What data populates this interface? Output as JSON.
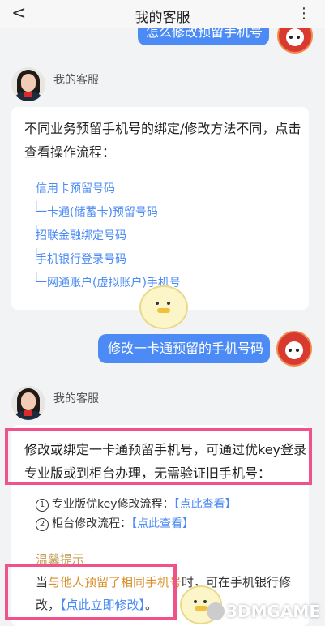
{
  "header": {
    "title": "我的客服",
    "back_glyph": "<",
    "more_glyph": "⋮"
  },
  "top_user_message": "怎么修改预留手机号",
  "conversation": {
    "agent_name": "我的客服",
    "agent_message_1": "不同业务预留手机号的绑定/修改方法不同，点击查看操作流程：",
    "links": [
      "信用卡预留号码",
      "一卡通(储蓄卡)预留号码",
      "招联金融绑定号码",
      "手机银行登录号码",
      "一网通账户(虚拟账户)手机号"
    ],
    "user_message_2": "修改一卡通预留的手机号码",
    "agent_message_2": "修改或绑定一卡通预留手机号，可通过优key登录专业版或到柜台办理，无需验证旧手机号：",
    "steps": [
      {
        "num": "1",
        "label": "专业版优key修改流程：",
        "link": "【点此查看】"
      },
      {
        "num": "2",
        "label": "柜台修改流程：",
        "link": "【点此查看】"
      }
    ],
    "tip": {
      "title": "温馨提示",
      "prefix": "当",
      "highlight": "与他人预留了相同手机号",
      "middle": "时，可在手机银行修改，",
      "link": "【点此立即修改】",
      "suffix": "。"
    }
  },
  "watermark": "3DMGAME",
  "colors": {
    "primary_blue": "#4c8bf5",
    "link_blue": "#4a8af4",
    "highlight_pink": "#f0528a",
    "highlight_orange": "#d98f2b"
  }
}
